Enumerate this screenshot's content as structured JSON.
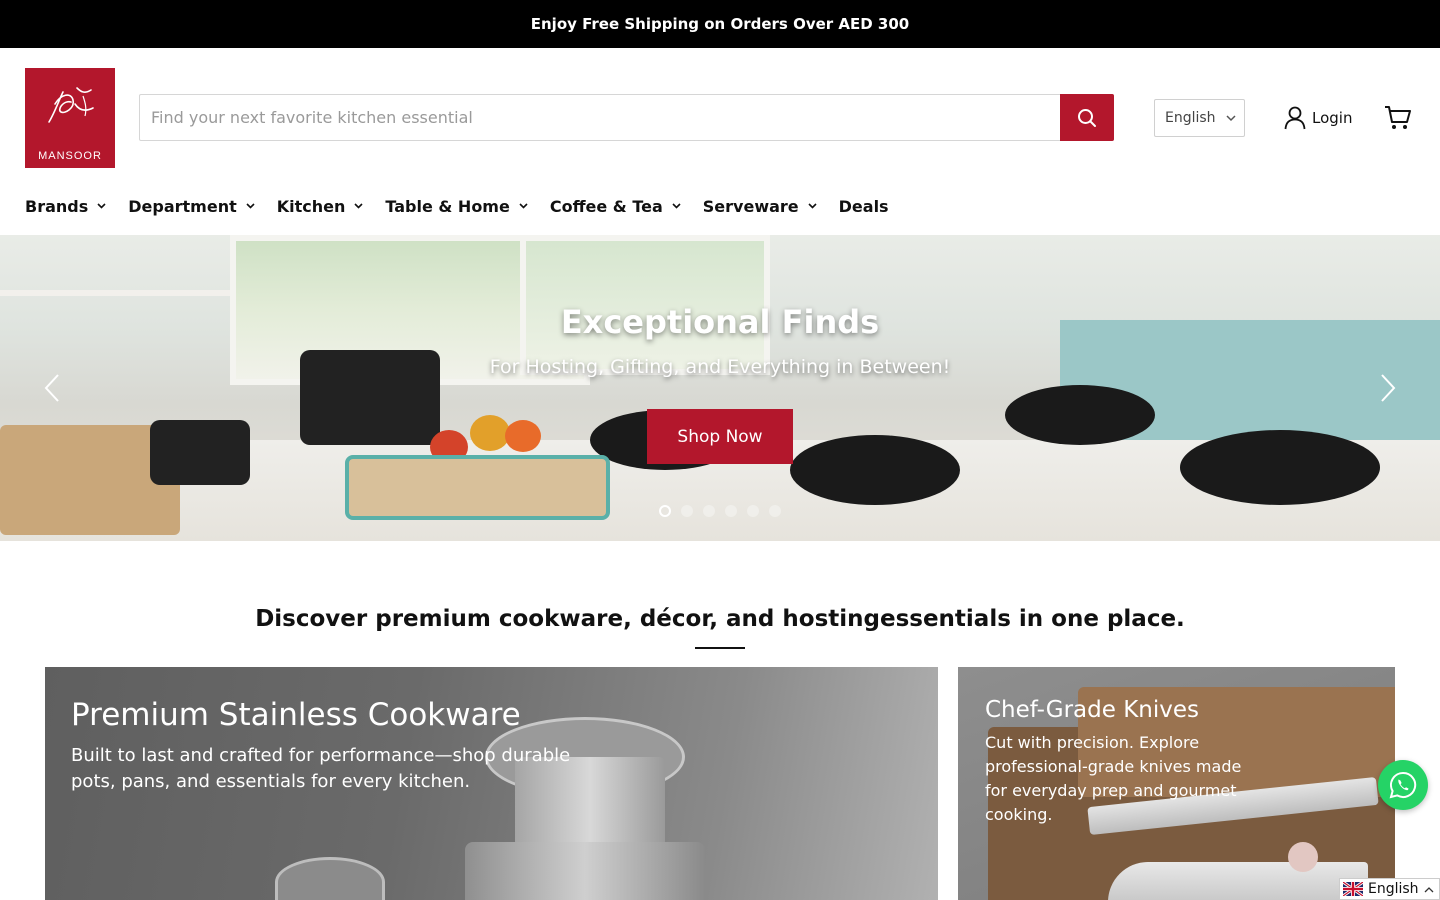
{
  "announcement": {
    "text": "Enjoy Free Shipping on Orders Over AED 300"
  },
  "brand": {
    "logo_text": "MANSOOR",
    "accent": "#b3172c"
  },
  "search": {
    "placeholder": "Find your next favorite kitchen essential",
    "value": "",
    "icon": "search-icon"
  },
  "language_select": {
    "selected": "English"
  },
  "account": {
    "login_label": "Login",
    "icon": "user-icon"
  },
  "cart": {
    "icon": "cart-icon"
  },
  "nav": {
    "items": [
      {
        "label": "Brands",
        "has_dropdown": true
      },
      {
        "label": "Department",
        "has_dropdown": true
      },
      {
        "label": "Kitchen",
        "has_dropdown": true
      },
      {
        "label": "Table & Home",
        "has_dropdown": true
      },
      {
        "label": "Coffee & Tea",
        "has_dropdown": true
      },
      {
        "label": "Serveware",
        "has_dropdown": true
      },
      {
        "label": "Deals",
        "has_dropdown": false
      }
    ]
  },
  "hero": {
    "title": "Exceptional Finds",
    "subtitle": "For Hosting, Gifting, and Everything in Between!",
    "cta_label": "Shop Now",
    "slide_count": 6,
    "active_slide": 1
  },
  "tagline": "Discover premium cookware, décor, and hostingessentials in one place.",
  "cards": [
    {
      "title": "Premium Stainless Cookware",
      "description": "Built to last and crafted for performance—shop durable pots, pans, and essentials for every kitchen."
    },
    {
      "title": "Chef-Grade Knives",
      "description": "Cut with precision. Explore professional-grade knives made for everyday prep and gourmet cooking."
    }
  ],
  "floating": {
    "whatsapp_icon": "whatsapp-icon"
  },
  "language_widget": {
    "label": "English",
    "flag": "uk-flag-icon"
  }
}
